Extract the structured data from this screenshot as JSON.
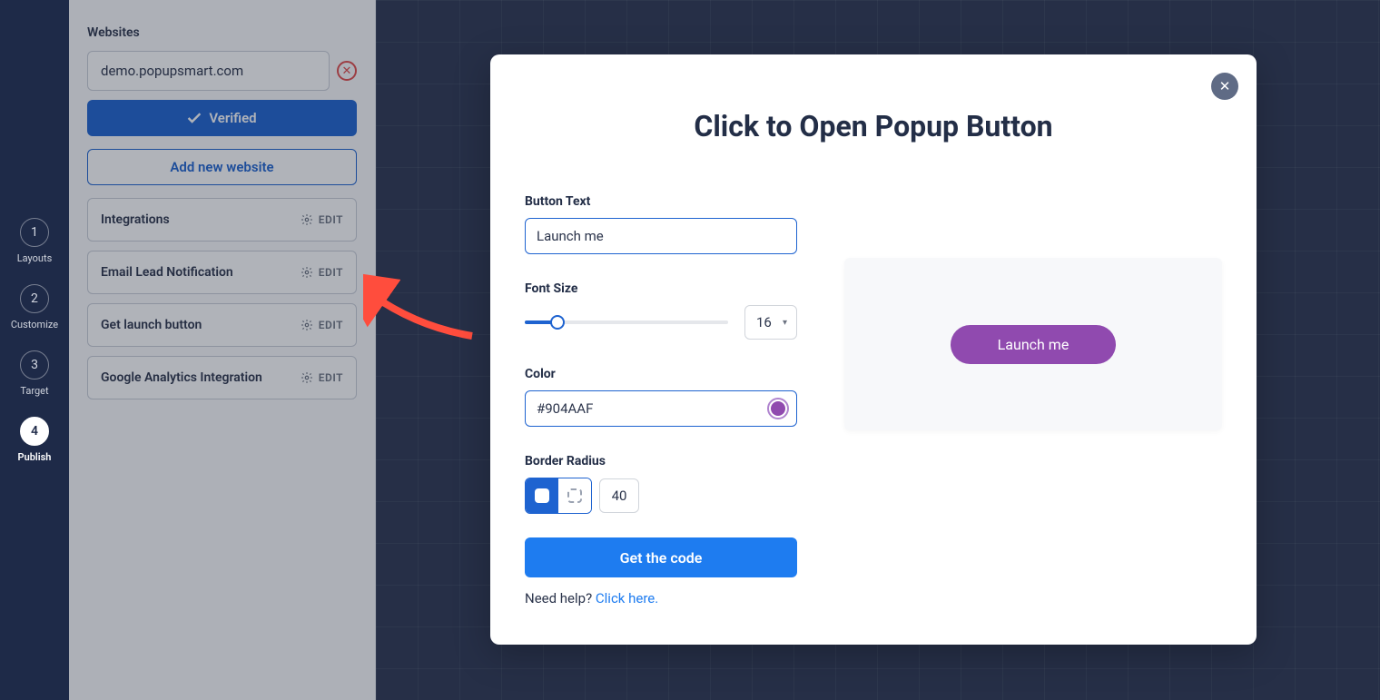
{
  "nav": {
    "steps": [
      {
        "num": "1",
        "label": "Layouts"
      },
      {
        "num": "2",
        "label": "Customize"
      },
      {
        "num": "3",
        "label": "Target"
      },
      {
        "num": "4",
        "label": "Publish"
      }
    ],
    "activeIndex": 3
  },
  "sidebar": {
    "heading": "Websites",
    "website": "demo.popupsmart.com",
    "verified": "Verified",
    "addWebsite": "Add new website",
    "options": [
      {
        "title": "Integrations",
        "action": "EDIT"
      },
      {
        "title": "Email Lead Notification",
        "action": "EDIT"
      },
      {
        "title": "Get launch button",
        "action": "EDIT"
      },
      {
        "title": "Google Analytics Integration",
        "action": "EDIT"
      }
    ]
  },
  "modal": {
    "title": "Click to Open Popup Button",
    "buttonTextLabel": "Button Text",
    "buttonText": "Launch me",
    "fontSizeLabel": "Font Size",
    "fontSize": "16",
    "colorLabel": "Color",
    "color": "#904AAF",
    "borderRadiusLabel": "Border Radius",
    "borderRadius": "40",
    "getCode": "Get the code",
    "helpText": "Need help? ",
    "helpLink": "Click here.",
    "previewButton": "Launch me"
  }
}
